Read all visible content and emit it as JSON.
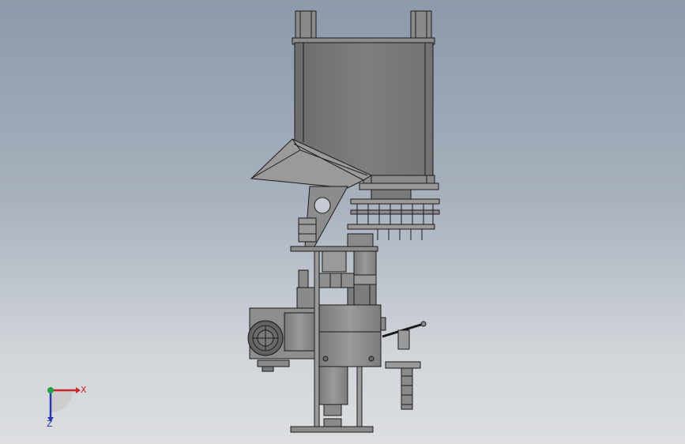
{
  "viewport": {
    "background_top": "#8d99aa",
    "background_bottom": "#dcdee0",
    "model_line_color": "#1b1b1b",
    "hopper_fill": "#7b7b7b",
    "part_fill": "#8e8e8e"
  },
  "model": {
    "parts": [
      "hopper",
      "hopper-left-bracket",
      "hopper-right-bracket",
      "chute",
      "gusset-plate",
      "rotary-table",
      "rotary-table-lower",
      "cam-assembly",
      "cylinders",
      "frame-columns",
      "gearbox",
      "motor",
      "motor-fan-cover",
      "handle-lever",
      "handwheel-grip",
      "spindle-motor",
      "base-foot"
    ]
  },
  "triad": {
    "x_label": "X",
    "z_label": "Z",
    "x_color": "#c82828",
    "y_color": "#1ea53c",
    "z_color": "#2838a8",
    "icon": "coordinate-triad-icon"
  }
}
